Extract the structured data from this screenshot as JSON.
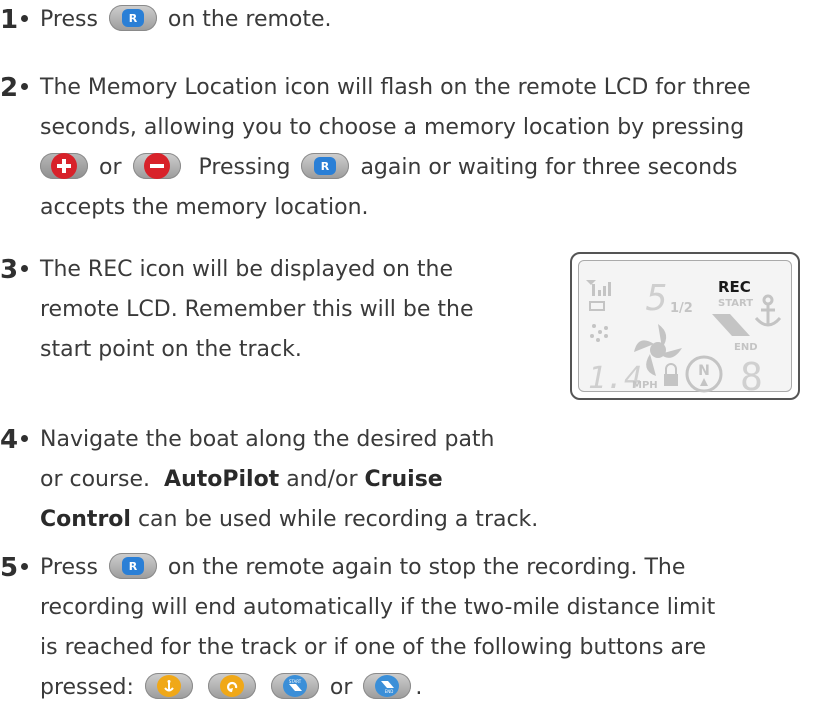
{
  "steps": [
    {
      "number": "1",
      "parts": {
        "a": "Press",
        "b": "on the remote."
      }
    },
    {
      "number": "2",
      "line1": "The Memory Location icon will flash on the remote LCD for three",
      "line2": "seconds, allowing you to choose a memory location by pressing",
      "line3_or": "or",
      "line3_pressing": "Pressing",
      "line3_rest": "again or waiting for three seconds",
      "line4": "accepts the memory location."
    },
    {
      "number": "3",
      "line1": "The REC icon will be displayed on the",
      "line2": "remote LCD.  Remember this will be the",
      "line3": "start point on the track."
    },
    {
      "number": "4",
      "line1": "Navigate the boat along the desired path",
      "line2_a": "or course.",
      "line2_bold": "AutoPilot",
      "line2_b": "and/or",
      "line2_bold2": "Cruise",
      "line3_bold": "Control",
      "line3_rest": "can be used while recording a track."
    },
    {
      "number": "5",
      "line1_a": "Press",
      "line1_b": "on the remote again to stop the recording.  The",
      "line2": "recording will end automatically if the two-mile distance limit",
      "line3": "is reached for the track or if one of the following buttons are",
      "line4_a": "pressed:",
      "line4_or": "or",
      "line4_end": "."
    }
  ],
  "lcd": {
    "rec": "REC",
    "start": "START",
    "end": "END",
    "half": "1/2",
    "speed": "1.4",
    "mph": "MPH",
    "compass": "N",
    "digit": "8",
    "memory": "5"
  },
  "buttons": {
    "r_label": "R",
    "start_label": "START",
    "end_label": "END"
  },
  "colors": {
    "r_button": "#2a7fd6",
    "plus_minus": "#d8222a",
    "anchor_return": "#f0a818",
    "start_end": "#3b8fd8"
  }
}
